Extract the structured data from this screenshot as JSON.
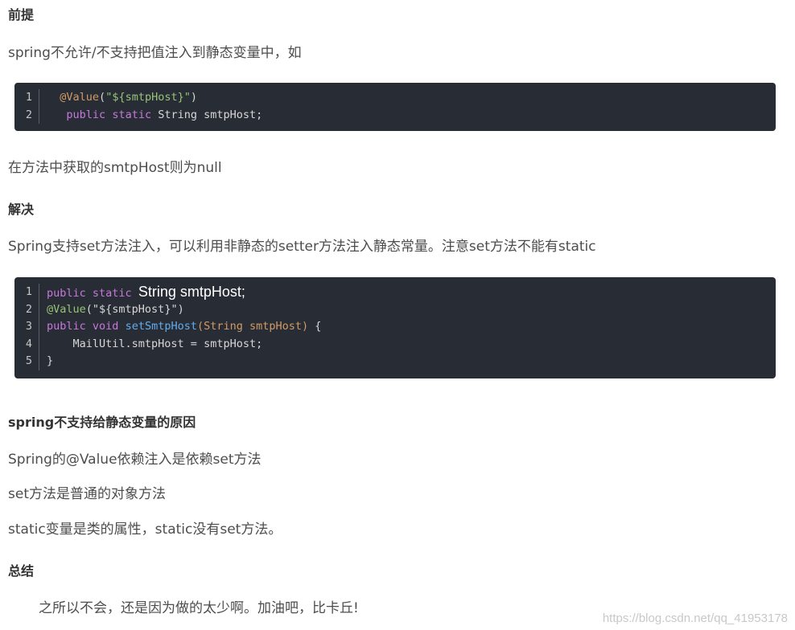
{
  "sections": {
    "premise": {
      "heading": "前提",
      "text": "spring不允许/不支持把值注入到静态变量中，如"
    },
    "code1": {
      "lines": [
        {
          "num": "1",
          "tokens": [
            {
              "t": "  ",
              "c": "plain"
            },
            {
              "t": "@Value",
              "c": "anno"
            },
            {
              "t": "(",
              "c": "plain"
            },
            {
              "t": "\"${smtpHost}\"",
              "c": "str"
            },
            {
              "t": ")",
              "c": "plain"
            }
          ]
        },
        {
          "num": "2",
          "tokens": [
            {
              "t": "   ",
              "c": "plain"
            },
            {
              "t": "public",
              "c": "kw"
            },
            {
              "t": " ",
              "c": "plain"
            },
            {
              "t": "static",
              "c": "kw"
            },
            {
              "t": " String smtpHost;",
              "c": "plain"
            }
          ]
        }
      ]
    },
    "null_note": "在方法中获取的smtpHost则为null",
    "solution": {
      "heading": "解决",
      "text": "Spring支持set方法注入，可以利用非静态的setter方法注入静态常量。注意set方法不能有static"
    },
    "code2": {
      "lines": [
        {
          "num": "1",
          "tokens": [
            {
              "t": "public",
              "c": "kw"
            },
            {
              "t": " ",
              "c": "plain"
            },
            {
              "t": "static",
              "c": "kw"
            },
            {
              "t": " ",
              "c": "plain"
            },
            {
              "t": "String smtpHost;",
              "c": "large"
            }
          ]
        },
        {
          "num": "2",
          "tokens": [
            {
              "t": "@Value",
              "c": "anno2"
            },
            {
              "t": "(\"${smtpHost}\")",
              "c": "plain"
            }
          ]
        },
        {
          "num": "3",
          "tokens": [
            {
              "t": "public",
              "c": "kw"
            },
            {
              "t": " ",
              "c": "plain"
            },
            {
              "t": "void",
              "c": "kw"
            },
            {
              "t": " ",
              "c": "plain"
            },
            {
              "t": "setSmtpHost",
              "c": "fn"
            },
            {
              "t": "(String smtpHost)",
              "c": "param"
            },
            {
              "t": " {",
              "c": "plain"
            }
          ]
        },
        {
          "num": "4",
          "tokens": [
            {
              "t": "    MailUtil.smtpHost = smtpHost;",
              "c": "plain"
            }
          ]
        },
        {
          "num": "5",
          "tokens": [
            {
              "t": "}",
              "c": "plain"
            }
          ]
        }
      ]
    },
    "reason": {
      "heading": "spring不支持给静态变量的原因",
      "lines": [
        "Spring的@Value依赖注入是依赖set方法",
        "set方法是普通的对象方法",
        "static变量是类的属性，static没有set方法。"
      ]
    },
    "summary": {
      "heading": "总结",
      "text": "之所以不会，还是因为做的太少啊。加油吧，比卡丘!"
    }
  },
  "watermark": "https://blog.csdn.net/qq_41953178"
}
